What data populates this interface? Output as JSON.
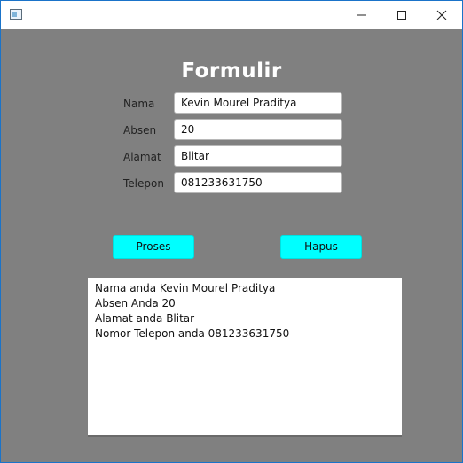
{
  "window": {
    "title": "",
    "minimize_icon": "minimize-icon",
    "maximize_icon": "maximize-icon",
    "close_icon": "close-icon"
  },
  "form": {
    "title": "Formulir",
    "fields": [
      {
        "label": "Nama",
        "value": "Kevin Mourel Praditya"
      },
      {
        "label": "Absen",
        "value": "20"
      },
      {
        "label": "Alamat",
        "value": "Blitar"
      },
      {
        "label": "Telepon",
        "value": "081233631750"
      }
    ],
    "buttons": {
      "proses": "Proses",
      "hapus": "Hapus"
    },
    "output_lines": [
      "Nama anda Kevin Mourel Praditya",
      "Absen Anda 20",
      "Alamat anda Blitar",
      "Nomor Telepon anda 081233631750"
    ]
  },
  "colors": {
    "background": "#808080",
    "button": "#00ffff",
    "title_text": "#ffffff"
  }
}
